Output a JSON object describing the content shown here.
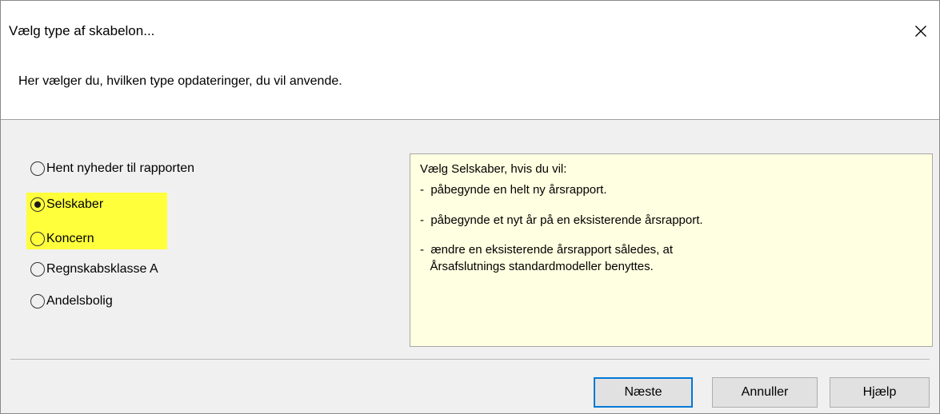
{
  "window": {
    "title": "Vælg type af skabelon...",
    "close_icon": "close-icon"
  },
  "header": {
    "text": "Her vælger du, hvilken type opdateringer, du vil anvende."
  },
  "options": [
    {
      "label": "Hent nyheder til rapporten",
      "selected": false,
      "highlighted": false
    },
    {
      "label": "Selskaber",
      "selected": true,
      "highlighted": true
    },
    {
      "label": "Koncern",
      "selected": false,
      "highlighted": true
    },
    {
      "label": "Regnskabsklasse A",
      "selected": false,
      "highlighted": false
    },
    {
      "label": "Andelsbolig",
      "selected": false,
      "highlighted": false
    }
  ],
  "info": {
    "lines": [
      "Vælg Selskaber, hvis du vil:",
      "-  påbegynde en helt ny årsrapport.",
      "-  påbegynde et nyt år på en eksisterende årsrapport.",
      "-  ændre en eksisterende årsrapport således, at",
      "   Årsafslutnings standardmodeller benyttes."
    ]
  },
  "buttons": {
    "next": "Næste",
    "cancel": "Annuller",
    "help": "Hjælp"
  },
  "colors": {
    "highlight": "#ffff3c",
    "info_background": "#ffffe1",
    "default_button_border": "#0078d7"
  }
}
